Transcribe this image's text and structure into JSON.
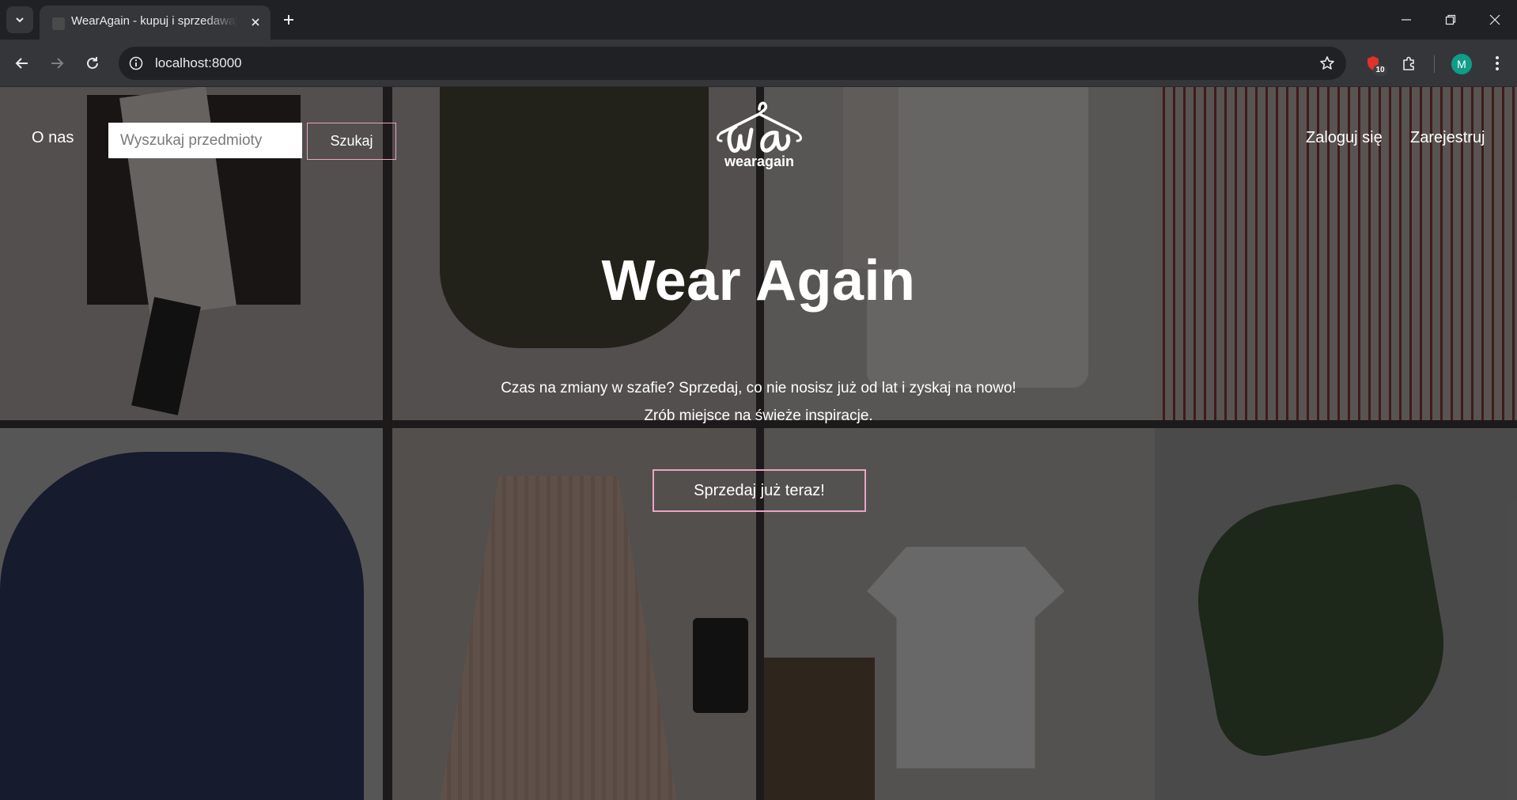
{
  "browser": {
    "tab_title": "WearAgain - kupuj i sprzedawaj",
    "url": "localhost:8000",
    "extension_badge": "10",
    "profile_initial": "M"
  },
  "header": {
    "about_label": "O nas",
    "search_placeholder": "Wyszukaj przedmioty",
    "search_button": "Szukaj",
    "logo_text": "wearagain",
    "login_label": "Zaloguj się",
    "register_label": "Zarejestruj"
  },
  "hero": {
    "title": "Wear Again",
    "line1": "Czas na zmiany w szafie? Sprzedaj, co nie nosisz już od lat i zyskaj na nowo!",
    "line2": "Zrób miejsce na świeże inspiracje.",
    "cta": "Sprzedaj już teraz!"
  },
  "colors": {
    "accent": "#e9a4c6",
    "overlay": "#141212"
  }
}
